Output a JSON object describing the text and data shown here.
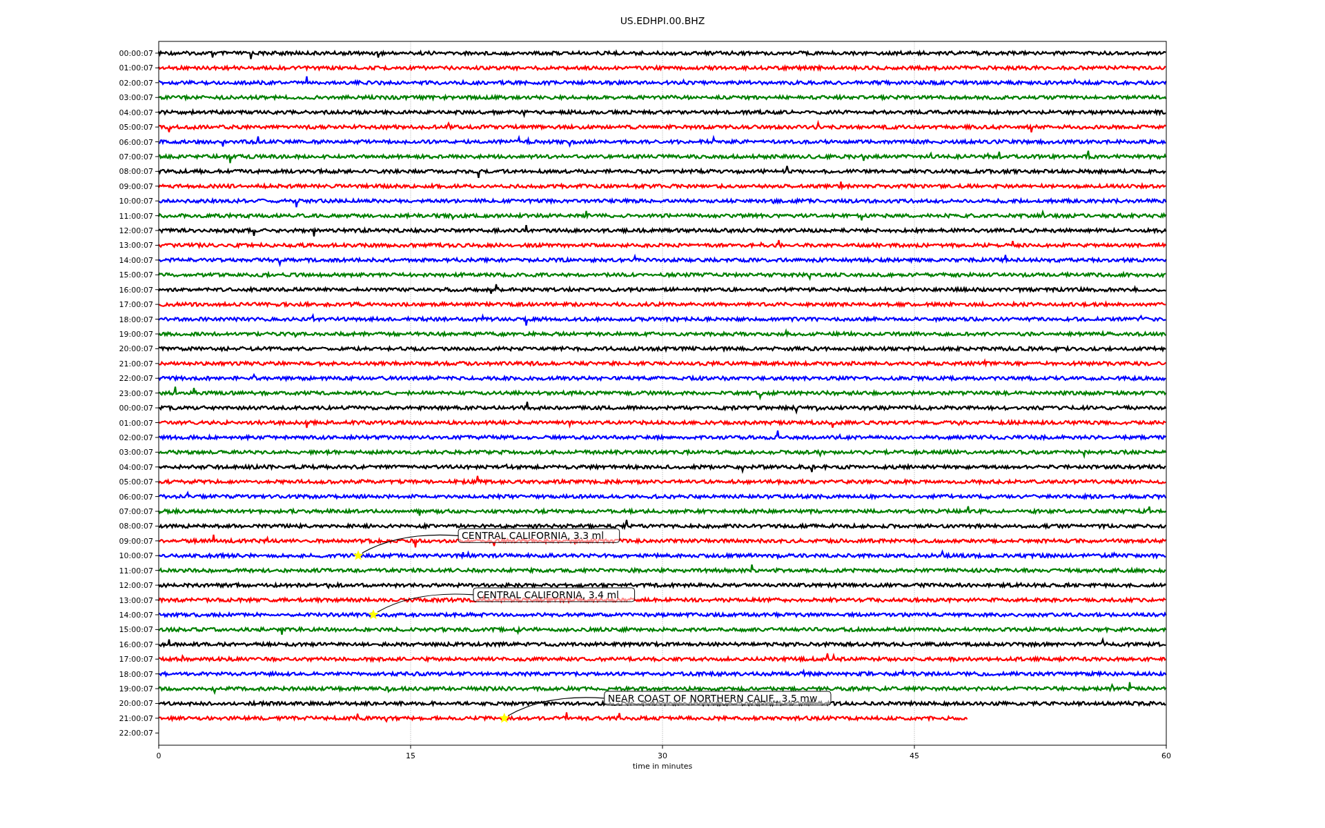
{
  "figure": {
    "title": "US.EDHPI.00.BHZ",
    "xlabel": "time in minutes",
    "xticks": [
      "0",
      "15",
      "30",
      "45",
      "60"
    ],
    "rows": [
      {
        "label": "00:00:07",
        "color": "#000000",
        "level": 1
      },
      {
        "label": "01:00:07",
        "color": "#ff0000",
        "level": 1
      },
      {
        "label": "02:00:07",
        "color": "#0000ff",
        "level": 1
      },
      {
        "label": "03:00:07",
        "color": "#008000",
        "level": 1
      },
      {
        "label": "04:00:07",
        "color": "#000000",
        "level": 1
      },
      {
        "label": "05:00:07",
        "color": "#ff0000",
        "level": 1
      },
      {
        "label": "06:00:07",
        "color": "#0000ff",
        "level": 1
      },
      {
        "label": "07:00:07",
        "color": "#008000",
        "level": 1
      },
      {
        "label": "08:00:07",
        "color": "#000000",
        "level": 1
      },
      {
        "label": "09:00:07",
        "color": "#ff0000",
        "level": 1
      },
      {
        "label": "10:00:07",
        "color": "#0000ff",
        "level": 1
      },
      {
        "label": "11:00:07",
        "color": "#008000",
        "level": 1
      },
      {
        "label": "12:00:07",
        "color": "#000000",
        "level": 1
      },
      {
        "label": "13:00:07",
        "color": "#ff0000",
        "level": 1
      },
      {
        "label": "14:00:07",
        "color": "#0000ff",
        "level": 1
      },
      {
        "label": "15:00:07",
        "color": "#008000",
        "level": 1
      },
      {
        "label": "16:00:07",
        "color": "#000000",
        "level": 1
      },
      {
        "label": "17:00:07",
        "color": "#ff0000",
        "level": 1
      },
      {
        "label": "18:00:07",
        "color": "#0000ff",
        "level": 1
      },
      {
        "label": "19:00:07",
        "color": "#008000",
        "level": 1
      },
      {
        "label": "20:00:07",
        "color": "#000000",
        "level": 1
      },
      {
        "label": "21:00:07",
        "color": "#ff0000",
        "level": 1
      },
      {
        "label": "22:00:07",
        "color": "#0000ff",
        "level": 1
      },
      {
        "label": "23:00:07",
        "color": "#008000",
        "level": 1
      },
      {
        "label": "00:00:07",
        "color": "#000000",
        "level": 1
      },
      {
        "label": "01:00:07",
        "color": "#ff0000",
        "level": 1
      },
      {
        "label": "02:00:07",
        "color": "#0000ff",
        "level": 1
      },
      {
        "label": "03:00:07",
        "color": "#008000",
        "level": 1
      },
      {
        "label": "04:00:07",
        "color": "#000000",
        "level": 1
      },
      {
        "label": "05:00:07",
        "color": "#ff0000",
        "level": 1
      },
      {
        "label": "06:00:07",
        "color": "#0000ff",
        "level": 1
      },
      {
        "label": "07:00:07",
        "color": "#008000",
        "level": 1
      },
      {
        "label": "08:00:07",
        "color": "#000000",
        "level": 1
      },
      {
        "label": "09:00:07",
        "color": "#ff0000",
        "level": 1
      },
      {
        "label": "10:00:07",
        "color": "#0000ff",
        "level": 1,
        "event": {
          "label": "CENTRAL CALIFORNIA, 3.3 ml"
        }
      },
      {
        "label": "11:00:07",
        "color": "#008000",
        "level": 1
      },
      {
        "label": "12:00:07",
        "color": "#000000",
        "level": 1
      },
      {
        "label": "13:00:07",
        "color": "#ff0000",
        "level": 1
      },
      {
        "label": "14:00:07",
        "color": "#0000ff",
        "level": 1,
        "event": {
          "label": "CENTRAL CALIFORNIA, 3.4 ml"
        }
      },
      {
        "label": "15:00:07",
        "color": "#008000",
        "level": 1
      },
      {
        "label": "16:00:07",
        "color": "#000000",
        "level": 1
      },
      {
        "label": "17:00:07",
        "color": "#ff0000",
        "level": 1
      },
      {
        "label": "18:00:07",
        "color": "#0000ff",
        "level": 1
      },
      {
        "label": "19:00:07",
        "color": "#008000",
        "level": 1
      },
      {
        "label": "20:00:07",
        "color": "#000000",
        "level": 1
      },
      {
        "label": "21:00:07",
        "color": "#ff0000",
        "level": 0.803,
        "event": {
          "label": "NEAR COAST OF NORTHERN CALIF., 3.5 mw"
        }
      },
      {
        "label": "22:00:07"
      }
    ]
  }
}
